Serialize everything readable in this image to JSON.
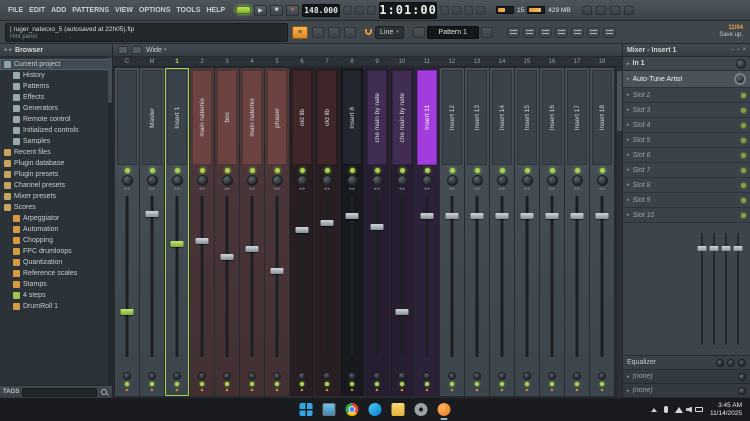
{
  "menu": [
    "FILE",
    "EDIT",
    "ADD",
    "PATTERNS",
    "VIEW",
    "OPTIONS",
    "TOOLS",
    "HELP"
  ],
  "transport": {
    "tempo": "148.000",
    "time": "1:01:00",
    "cpu": "15",
    "mem": "429 MB"
  },
  "hint": {
    "title": "| ruger_natecxo_5 (autosaved at 22h05).flp",
    "label": "Hint panel"
  },
  "toolbar": {
    "snap_label": "Line",
    "pattern_label": "Pattern 1",
    "date_badge": "11/04",
    "save_label": "Save up."
  },
  "browser": {
    "title": "Browser",
    "tags_label": "TAGS",
    "items": [
      {
        "label": "Current project",
        "indent": 0,
        "icon": "folder",
        "color": "#8fa0aa",
        "selected": true
      },
      {
        "label": "History",
        "indent": 1,
        "icon": "history",
        "color": "#9aa8b0"
      },
      {
        "label": "Patterns",
        "indent": 1,
        "icon": "patterns",
        "color": "#9aa8b0"
      },
      {
        "label": "Effects",
        "indent": 1,
        "icon": "effects",
        "color": "#9aa8b0"
      },
      {
        "label": "Generators",
        "indent": 1,
        "icon": "generators",
        "color": "#9aa8b0"
      },
      {
        "label": "Remote control",
        "indent": 1,
        "icon": "remote-control",
        "color": "#9aa8b0"
      },
      {
        "label": "Initialized controls",
        "indent": 1,
        "icon": "controls",
        "color": "#9aa8b0"
      },
      {
        "label": "Samples",
        "indent": 1,
        "icon": "samples",
        "color": "#9aa8b0"
      },
      {
        "label": "Recent files",
        "indent": 0,
        "icon": "folder",
        "color": "#c7a25a"
      },
      {
        "label": "Plugin database",
        "indent": 0,
        "icon": "folder",
        "color": "#c7a25a"
      },
      {
        "label": "Plugin presets",
        "indent": 0,
        "icon": "folder",
        "color": "#c7a25a"
      },
      {
        "label": "Channel presets",
        "indent": 0,
        "icon": "folder",
        "color": "#c7a25a"
      },
      {
        "label": "Mixer presets",
        "indent": 0,
        "icon": "folder",
        "color": "#c7a25a"
      },
      {
        "label": "Scores",
        "indent": 0,
        "icon": "folder",
        "color": "#c7a25a"
      },
      {
        "label": "Arpeggiator",
        "indent": 1,
        "icon": "note",
        "color": "#d89a40"
      },
      {
        "label": "Automation",
        "indent": 1,
        "icon": "note",
        "color": "#d89a40"
      },
      {
        "label": "Chopping",
        "indent": 1,
        "icon": "note",
        "color": "#d89a40"
      },
      {
        "label": "FPC drumloops",
        "indent": 1,
        "icon": "note",
        "color": "#d89a40"
      },
      {
        "label": "Quantization",
        "indent": 1,
        "icon": "note",
        "color": "#d89a40"
      },
      {
        "label": "Reference scales",
        "indent": 1,
        "icon": "note",
        "color": "#d89a40"
      },
      {
        "label": "Stamps",
        "indent": 1,
        "icon": "note",
        "color": "#d89a40"
      },
      {
        "label": "4 steps",
        "indent": 1,
        "icon": "pattern",
        "color": "#9cc84a"
      },
      {
        "label": "DrumRoll 1",
        "indent": 1,
        "icon": "pattern",
        "color": "#d89a40"
      }
    ]
  },
  "mixer": {
    "toolbar_label": "Wide",
    "columns": [
      "C",
      "M",
      "1",
      "2",
      "3",
      "4",
      "5",
      "6",
      "7",
      "8",
      "9",
      "10",
      "11",
      "12",
      "13",
      "14",
      "15",
      "16",
      "17",
      "18"
    ],
    "channels": [
      {
        "name": "",
        "type": "default",
        "fader": 0.2,
        "hl": true
      },
      {
        "name": "Master",
        "type": "default",
        "fader": 0.92
      },
      {
        "name": "Insert 1",
        "type": "default",
        "fader": 0.7,
        "selected": true,
        "hl": true
      },
      {
        "name": "main natemix",
        "type": "red",
        "fader": 0.72
      },
      {
        "name": "bos",
        "type": "red",
        "fader": 0.6
      },
      {
        "name": "main natemix",
        "type": "red",
        "fader": 0.66
      },
      {
        "name": "phaser",
        "type": "red",
        "fader": 0.5
      },
      {
        "name": "old lib",
        "type": "darkred",
        "fader": 0.8
      },
      {
        "name": "old lib",
        "type": "darkred",
        "fader": 0.85
      },
      {
        "name": "Insert 8",
        "type": "black",
        "fader": 0.9
      },
      {
        "name": "che main by nate",
        "type": "purple",
        "fader": 0.82
      },
      {
        "name": "che main by nate",
        "type": "purple",
        "fader": 0.2
      },
      {
        "name": "Insert 11",
        "type": "purplehl",
        "fader": 0.9
      },
      {
        "name": "Insert 12",
        "type": "default",
        "fader": 0.9
      },
      {
        "name": "Insert 13",
        "type": "default",
        "fader": 0.9
      },
      {
        "name": "Insert 14",
        "type": "default",
        "fader": 0.9
      },
      {
        "name": "Insert 15",
        "type": "default",
        "fader": 0.9
      },
      {
        "name": "Insert 16",
        "type": "default",
        "fader": 0.9
      },
      {
        "name": "Insert 17",
        "type": "default",
        "fader": 0.9
      },
      {
        "name": "Insert 18",
        "type": "default",
        "fader": 0.9
      }
    ]
  },
  "insert_panel": {
    "title": "Mixer - Insert 1",
    "input_label": "In 1",
    "slots": [
      {
        "label": "Auto-Tune Artist",
        "active": true
      },
      {
        "label": "Slot 2"
      },
      {
        "label": "Slot 3"
      },
      {
        "label": "Slot 4"
      },
      {
        "label": "Slot 5"
      },
      {
        "label": "Slot 6"
      },
      {
        "label": "Slot 7"
      },
      {
        "label": "Slot 8"
      },
      {
        "label": "Slot 9"
      },
      {
        "label": "Slot 10"
      }
    ],
    "equalizer_label": "Equalizer",
    "sends": [
      "(none)",
      "(none)"
    ]
  },
  "taskbar": {
    "icons": [
      "start",
      "desktop",
      "chrome",
      "edge",
      "file-explorer",
      "settings",
      "fl-studio"
    ],
    "time": "3:45 AM",
    "date": "11/14/2025"
  },
  "colors": {
    "accent_green": "#a6d44a",
    "accent_orange": "#e8973a",
    "selected_purple": "#a23cdd"
  }
}
